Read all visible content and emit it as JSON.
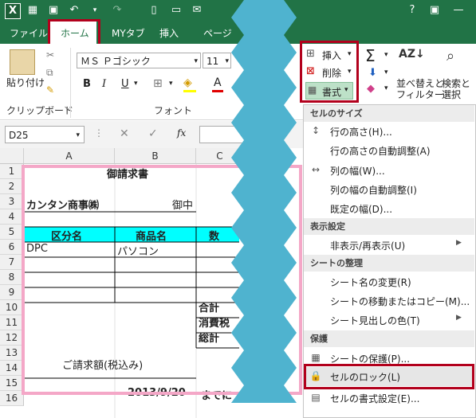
{
  "tabs": [
    "ファイル",
    "ホーム",
    "MYタブ",
    "挿入",
    "ページ"
  ],
  "font": {
    "name": "ＭＳ Ｐゴシック",
    "size": "11"
  },
  "clipboard": {
    "paste": "貼り付け",
    "group": "クリップボード"
  },
  "font_group": "フォント",
  "cells_group": {
    "insert": "挿入",
    "delete": "削除",
    "format": "書式"
  },
  "editing": {
    "sort": "並べ替えと",
    "filter": "フィルター",
    "find": "検索と",
    "select": "選択"
  },
  "namebox": "D25",
  "fx": "fx",
  "columns": [
    "A",
    "B",
    "C"
  ],
  "rows": [
    "1",
    "2",
    "3",
    "4",
    "5",
    "6",
    "7",
    "8",
    "9",
    "10",
    "11",
    "12",
    "13",
    "14",
    "15",
    "16"
  ],
  "sheet": {
    "title": "御請求書",
    "company": "カンタン商事㈱",
    "onchu": "御中",
    "hdr_a": "区分名",
    "hdr_b": "商品名",
    "hdr_c": "数",
    "row6_a": "DPC",
    "row6_b": "パソコン",
    "total": "合計",
    "tax": "消費税",
    "grand": "総計",
    "request": "ご請求額(税込み)",
    "date": "2013/9/20",
    "until": "までに"
  },
  "menu": {
    "sec_size": "セルのサイズ",
    "row_height": "行の高さ(H)...",
    "row_auto": "行の高さの自動調整(A)",
    "col_width": "列の幅(W)...",
    "col_auto": "列の幅の自動調整(I)",
    "default_width": "既定の幅(D)...",
    "sec_visibility": "表示設定",
    "hide_show": "非表示/再表示(U)",
    "sec_organize": "シートの整理",
    "rename": "シート名の変更(R)",
    "move_copy": "シートの移動またはコピー(M)...",
    "tab_color": "シート見出しの色(T)",
    "sec_protect": "保護",
    "protect_sheet": "シートの保護(P)...",
    "lock_cell": "セルのロック(L)",
    "format_cells": "セルの書式設定(E)..."
  },
  "colors": {
    "excel_green": "#217346",
    "highlight": "#00ffff",
    "callout_red": "#b2001c",
    "zigzag": "#4fb3cf",
    "pink": "#f4a7c7"
  }
}
